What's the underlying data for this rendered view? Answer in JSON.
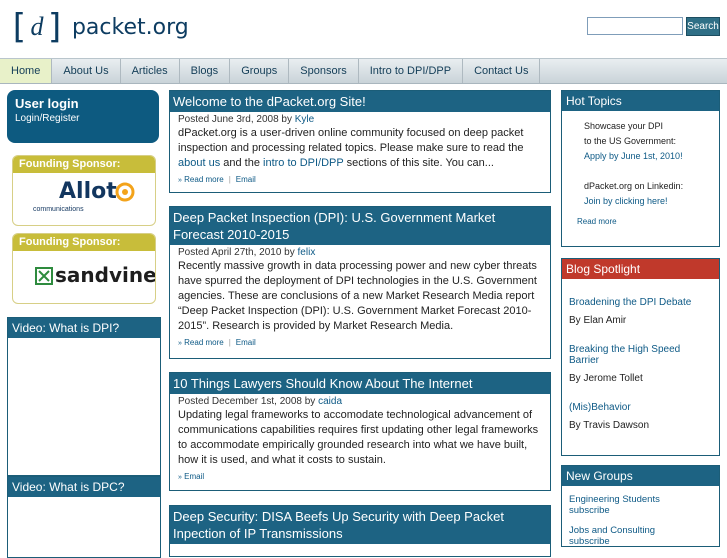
{
  "site": {
    "bracket_left": "[",
    "d": "d",
    "bracket_right": "]",
    "name": "packet.org"
  },
  "search": {
    "placeholder": "",
    "button_label": "Search"
  },
  "nav": [
    "Home",
    "About Us",
    "Articles",
    "Blogs",
    "Groups",
    "Sponsors",
    "Intro to DPI/DPP",
    "Contact Us"
  ],
  "user_login": {
    "title": "User login",
    "link": "Login/Register"
  },
  "sponsors": [
    {
      "head": "Founding Sponsor:",
      "brand": "Allot",
      "tagline": "communications"
    },
    {
      "head": "Founding Sponsor:",
      "brand": "sandvine"
    }
  ],
  "videos": [
    {
      "title": "Video: What is DPI?"
    },
    {
      "title": "Video: What is DPC?"
    }
  ],
  "posts": [
    {
      "title": "Welcome to the dPacket.org Site!",
      "posted": "Posted June 3rd, 2008 by",
      "author": "Kyle",
      "body_1": "dPacket.org is a user-driven online community focused on deep packet inspection and processing related topics. Please make sure to read the",
      "link_a": "about us",
      "body_2": "and the",
      "link_b": "intro to DPI/DPP",
      "body_3": "sections of this site. You can...",
      "read_more": "Read more",
      "email": "Email"
    },
    {
      "title": "Deep Packet Inspection (DPI): U.S. Government Market Forecast 2010-2015",
      "posted": "Posted April 27th, 2010 by",
      "author": "felix",
      "body": "Recently massive growth in data processing power and new cyber threats have spurred the deployment of DPI technologies in the U.S. Government agencies. These are conclusions of a new Market Research Media report “Deep Packet Inspection (DPI): U.S. Government Market Forecast 2010-2015”.  Research is provided by Market Research Media.",
      "read_more": "Read more",
      "email": "Email"
    },
    {
      "title": "10 Things Lawyers Should Know About The Internet",
      "posted": "Posted December 1st, 2008 by",
      "author": "caida",
      "body": "Updating legal frameworks to accomodate technological advancement of communications capabilities requires first updating other legal frameworks to accommodate empirically grounded research into what we have built, how it is used, and what it costs to sustain.",
      "email": "Email"
    },
    {
      "title": "Deep Security: DISA Beefs Up Security with Deep Packet Inpection of IP Transmissions"
    }
  ],
  "hot_topics": {
    "title": "Hot Topics",
    "line1": "Showcase your DPI",
    "line2": "to the US Government:",
    "link1": "Apply by June 1st, 2010!",
    "line3": "dPacket.org on Linkedin:",
    "link2": "Join by clicking here!",
    "read_more": "Read more"
  },
  "blog_spotlight": {
    "title": "Blog Spotlight",
    "items": [
      {
        "title": "Broadening the DPI Debate",
        "author": "By Elan Amir"
      },
      {
        "title": "Breaking the High Speed Barrier",
        "author": "By Jerome Tollet"
      },
      {
        "title": "(Mis)Behavior",
        "author": "By Travis Dawson"
      }
    ]
  },
  "new_groups": {
    "title": "New Groups",
    "items": [
      "Engineering Students subscribe",
      "Jobs and Consulting subscribe"
    ]
  },
  "colors": {
    "header_bar": "#1d6383",
    "accent_red": "#c0392b",
    "sponsor_gold": "#c8bd3a",
    "link": "#0e5a86"
  }
}
